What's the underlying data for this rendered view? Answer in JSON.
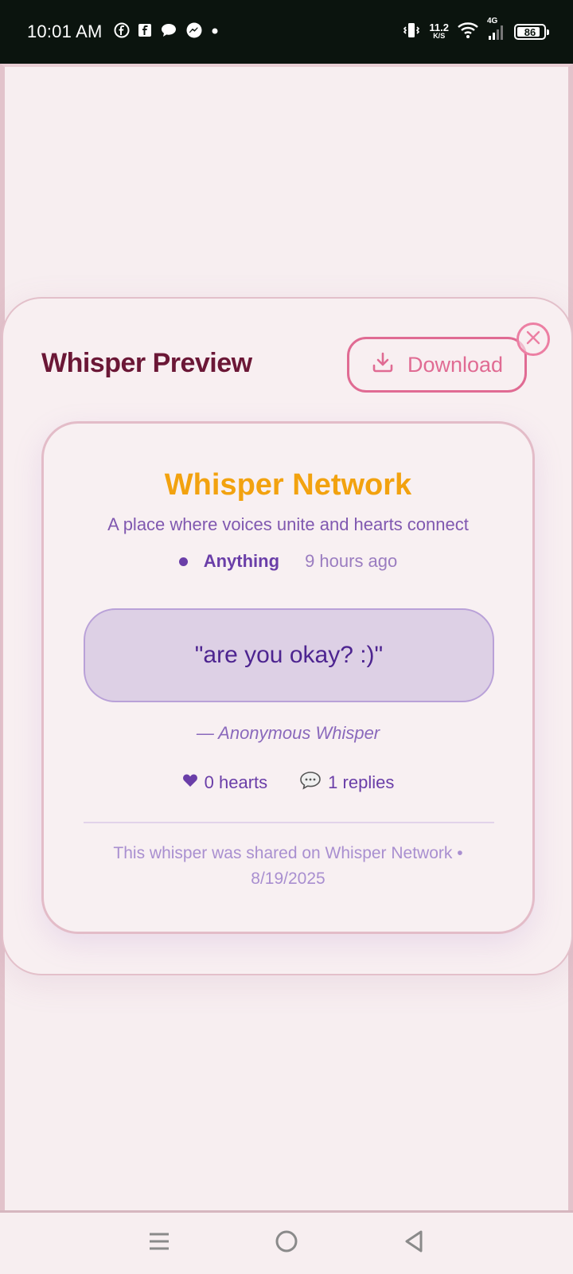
{
  "status_bar": {
    "time": "10:01 AM",
    "net_speed_value": "11.2",
    "net_speed_unit": "K/S",
    "network_type": "4G",
    "battery_level": "86",
    "notification_icons": [
      "facebook-icon",
      "facebook-page-icon",
      "chat-bubble-icon",
      "messenger-icon",
      "dot-icon"
    ]
  },
  "modal": {
    "title": "Whisper Preview",
    "download_label": "Download"
  },
  "card": {
    "brand": "Whisper Network",
    "tagline": "A place where voices unite and hearts connect",
    "category": "Anything",
    "time_ago": "9 hours ago",
    "quote": "\"are you okay? :)\"",
    "attribution": "— Anonymous Whisper",
    "hearts": "0 hearts",
    "replies": "1 replies",
    "footer": "This whisper was shared on Whisper Network • 8/19/2025"
  },
  "colors": {
    "title": "#6b1736",
    "accent_pink": "#e06b93",
    "brand_orange": "#f2a20f",
    "purple": "#6a3ea8"
  }
}
